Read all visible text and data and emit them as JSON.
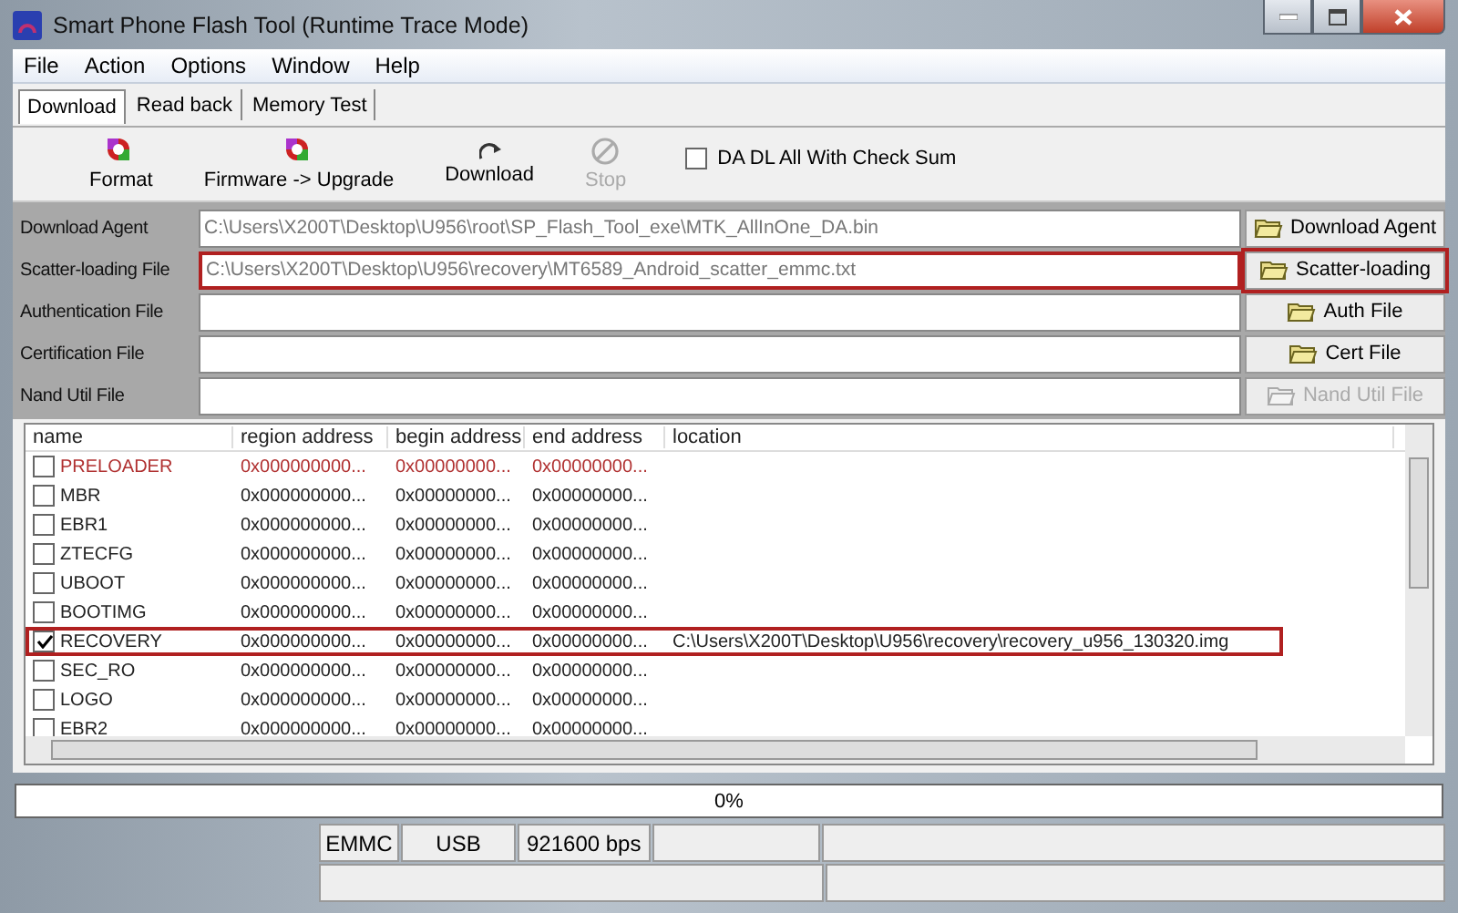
{
  "window": {
    "title": "Smart Phone Flash Tool (Runtime Trace Mode)"
  },
  "menu": [
    "File",
    "Action",
    "Options",
    "Window",
    "Help"
  ],
  "tabs": [
    {
      "label": "Download",
      "selected": true
    },
    {
      "label": "Read back",
      "selected": false
    },
    {
      "label": "Memory Test",
      "selected": false
    }
  ],
  "toolbar": [
    {
      "label": "Format",
      "kind": "format",
      "disabled": false
    },
    {
      "label": "Firmware -> Upgrade",
      "kind": "format",
      "disabled": false
    },
    {
      "label": "Download",
      "kind": "download",
      "disabled": false
    },
    {
      "label": "Stop",
      "kind": "stop",
      "disabled": true
    }
  ],
  "checksum_option": {
    "label": "DA DL All With Check Sum",
    "checked": false
  },
  "files": [
    {
      "label": "Download Agent",
      "value": "C:\\Users\\X200T\\Desktop\\U956\\root\\SP_Flash_Tool_exe\\MTK_AllInOne_DA.bin",
      "button": "Download Agent",
      "disabled": false,
      "highlighted": false
    },
    {
      "label": "Scatter-loading File",
      "value": "C:\\Users\\X200T\\Desktop\\U956\\recovery\\MT6589_Android_scatter_emmc.txt",
      "button": "Scatter-loading",
      "disabled": false,
      "highlighted": true
    },
    {
      "label": "Authentication File",
      "button": "Auth File",
      "disabled": false,
      "highlighted": false
    },
    {
      "label": "Certification File",
      "button": "Cert File",
      "disabled": false,
      "highlighted": false
    },
    {
      "label": "Nand Util File",
      "button": "Nand Util File",
      "disabled": true,
      "highlighted": false
    }
  ],
  "table": {
    "columns": [
      "name",
      "region address",
      "begin address",
      "end address",
      "location"
    ],
    "rows": [
      {
        "name": "PRELOADER",
        "region": "0x000000000...",
        "begin": "0x00000000...",
        "end": "0x00000000...",
        "checked": false,
        "warning": true,
        "highlighted": false
      },
      {
        "name": "MBR",
        "region": "0x000000000...",
        "begin": "0x00000000...",
        "end": "0x00000000...",
        "checked": false,
        "warning": false,
        "highlighted": false
      },
      {
        "name": "EBR1",
        "region": "0x000000000...",
        "begin": "0x00000000...",
        "end": "0x00000000...",
        "checked": false,
        "warning": false,
        "highlighted": false
      },
      {
        "name": "ZTECFG",
        "region": "0x000000000...",
        "begin": "0x00000000...",
        "end": "0x00000000...",
        "checked": false,
        "warning": false,
        "highlighted": false
      },
      {
        "name": "UBOOT",
        "region": "0x000000000...",
        "begin": "0x00000000...",
        "end": "0x00000000...",
        "checked": false,
        "warning": false,
        "highlighted": false
      },
      {
        "name": "BOOTIMG",
        "region": "0x000000000...",
        "begin": "0x00000000...",
        "end": "0x00000000...",
        "checked": false,
        "warning": false,
        "highlighted": false
      },
      {
        "name": "RECOVERY",
        "region": "0x000000000...",
        "begin": "0x00000000...",
        "end": "0x00000000...",
        "location": "C:\\Users\\X200T\\Desktop\\U956\\recovery\\recovery_u956_130320.img",
        "checked": true,
        "warning": false,
        "highlighted": true
      },
      {
        "name": "SEC_RO",
        "region": "0x000000000...",
        "begin": "0x00000000...",
        "end": "0x00000000...",
        "checked": false,
        "warning": false,
        "highlighted": false
      },
      {
        "name": "LOGO",
        "region": "0x000000000...",
        "begin": "0x00000000...",
        "end": "0x00000000...",
        "checked": false,
        "warning": false,
        "highlighted": false
      },
      {
        "name": "EBR2",
        "region": "0x000000000...",
        "begin": "0x00000000...",
        "end": "0x00000000...",
        "checked": false,
        "warning": false,
        "highlighted": false
      }
    ]
  },
  "progress": {
    "level": 0,
    "text": "0%"
  },
  "status_bar": {
    "storage": "EMMC",
    "port": "USB",
    "baud_rate": "921600 bps"
  }
}
